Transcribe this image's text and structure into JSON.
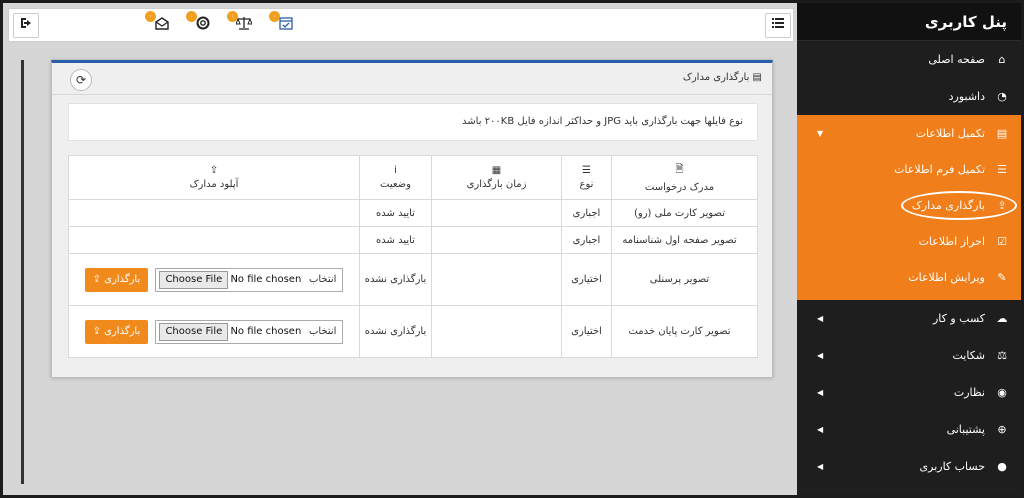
{
  "sidebar": {
    "title": "پنل کاربری",
    "items": [
      {
        "label": "صفحه اصلی",
        "icon": "home-icon"
      },
      {
        "label": "داشبورد",
        "icon": "dashboard-icon"
      },
      {
        "label": "تکمیل اطلاعات",
        "icon": "id-card-icon"
      },
      {
        "label": "کسب و کار",
        "icon": "cloud-icon"
      },
      {
        "label": "شکایت",
        "icon": "scale-icon"
      },
      {
        "label": "نظارت",
        "icon": "eye-icon"
      },
      {
        "label": "پشتیبانی",
        "icon": "globe-icon"
      },
      {
        "label": "حساب کاربری",
        "icon": "user-icon"
      }
    ],
    "submenu": [
      {
        "label": "تکمیل فرم اطلاعات",
        "icon": "list-icon"
      },
      {
        "label": "بارگذاری مدارک",
        "icon": "upload-icon"
      },
      {
        "label": "احراز اطلاعات",
        "icon": "checkbox-icon"
      },
      {
        "label": "ویرایش اطلاعات",
        "icon": "edit-icon"
      }
    ]
  },
  "topbar": {
    "badges": [
      "۰",
      "۰",
      "۰",
      "۰"
    ]
  },
  "panel": {
    "title": "بارگذاری مدارک",
    "note": "نوع فایلها جهت بارگذاری باید JPG و حداکثر اندازه فایل ۲۰۰KB باشد"
  },
  "table": {
    "headers": {
      "document": "مدرک درخواست",
      "type": "نوع",
      "time": "زمان بارگذاری",
      "status": "وضعیت",
      "upload": "آپلود مدارک"
    },
    "rows": [
      {
        "document": "تصویر کارت ملی (رو)",
        "type": "اجباری",
        "time": "",
        "status": "تایید شده"
      },
      {
        "document": "تصویر صفحه اول شناسنامه",
        "type": "اجباری",
        "time": "",
        "status": "تایید شده"
      },
      {
        "document": "تصویر پرسنلی",
        "type": "اختیاری",
        "time": "",
        "status": "بارگذاری نشده"
      },
      {
        "document": "تصویر کارت پایان خدمت",
        "type": "اختیاری",
        "time": "",
        "status": "بارگذاری نشده"
      }
    ],
    "file_label": "انتخاب",
    "choose_file": "Choose File",
    "no_file": "No file chosen",
    "upload_button": "بارگذاری"
  },
  "colors": {
    "accent": "#f07e1a",
    "sidebar_bg": "#1e1e1e",
    "panel_border": "#2b5ea8"
  }
}
